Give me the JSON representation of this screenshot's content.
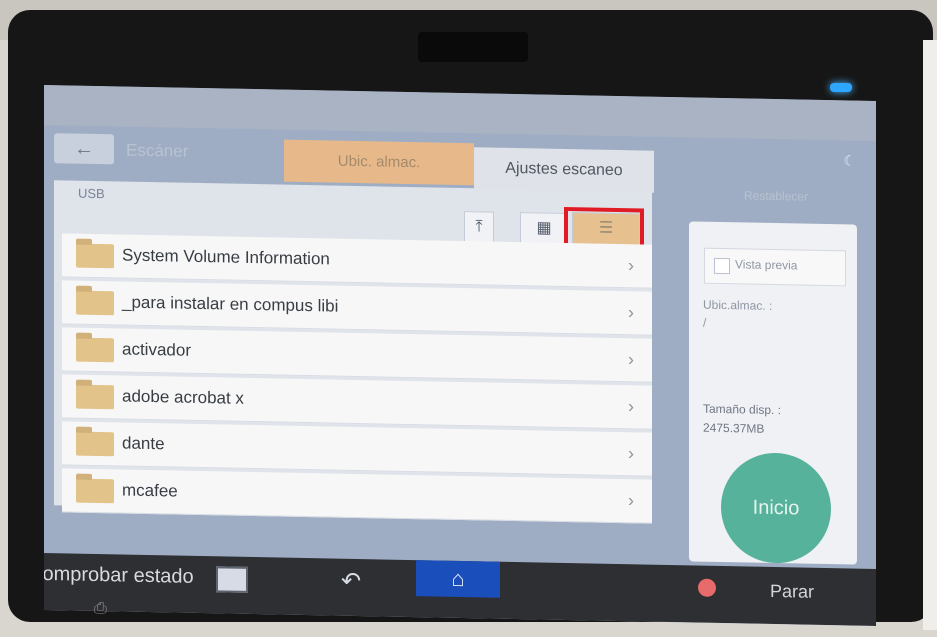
{
  "screen": {
    "title": "Escáner",
    "tabs": [
      "Ubic. almac.",
      "Ajustes escaneo"
    ],
    "restore_label": "Restablecer",
    "breadcrumb": "USB",
    "files": [
      {
        "name": "System Volume Information"
      },
      {
        "name": "_para instalar en compus libi"
      },
      {
        "name": "activador"
      },
      {
        "name": "adobe acrobat x"
      },
      {
        "name": "dante"
      },
      {
        "name": "mcafee"
      }
    ],
    "preview_label": "Vista previa",
    "location_label": "Ubic.almac. :",
    "location_value": "/",
    "size_label": "Tamaño disp. :",
    "size_value": "2475.37MB",
    "start_label": "Inicio",
    "status_label": "Comprobar estado",
    "stop_label": "Parar"
  },
  "colors": {
    "tab_active": "#e7b98a",
    "start_button": "#56b29a",
    "home_button": "#1a4fbb",
    "highlight": "#e11b25"
  },
  "icons": {
    "back": "back-arrow-icon",
    "upload": "upload-icon",
    "grid": "grid-view-icon",
    "list": "list-view-icon",
    "home": "home-icon",
    "return": "return-icon",
    "stop": "stop-icon"
  }
}
